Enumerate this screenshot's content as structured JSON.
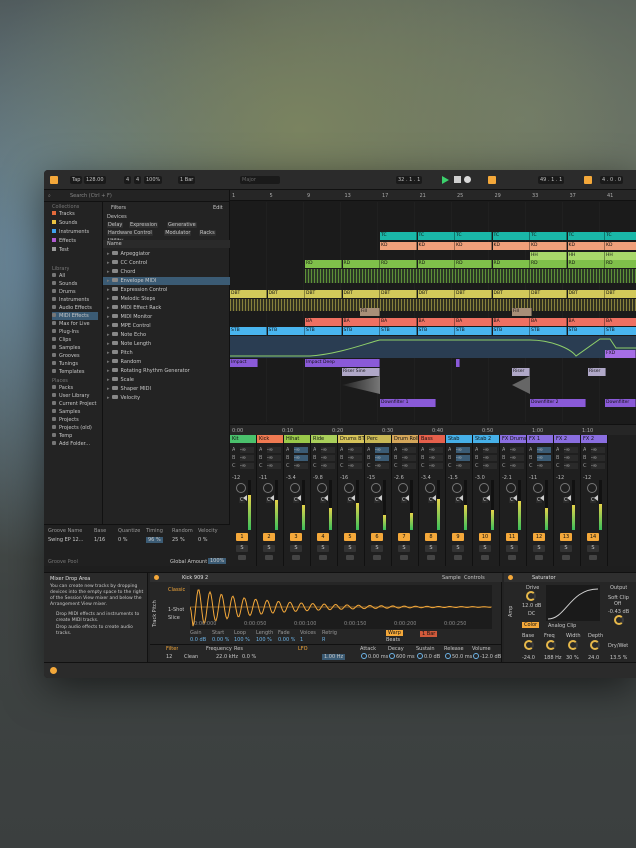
{
  "toolbar": {
    "tap": "Tap",
    "tempo": "128.00",
    "sig_num": "4",
    "sig_den": "4",
    "zoom": "100%",
    "quant": "1 Bar",
    "key": "Major",
    "position": "32 . 1 . 1",
    "loop_start": "49 . 1 . 1",
    "loop_len": "4 . 0 . 0"
  },
  "search": {
    "placeholder": "Search (Ctrl + F)"
  },
  "collections": {
    "title": "Collections",
    "items": [
      {
        "label": "Tracks",
        "color": "#e36a3b"
      },
      {
        "label": "Sounds",
        "color": "#ebc341"
      },
      {
        "label": "Instruments",
        "color": "#3fa3f0"
      },
      {
        "label": "Effects",
        "color": "#b25bd3"
      },
      {
        "label": "Test",
        "color": "#9a9a9a"
      }
    ]
  },
  "library": {
    "title": "Library",
    "items": [
      "All",
      "Sounds",
      "Drums",
      "Instruments",
      "Audio Effects",
      "MIDI Effects",
      "Max for Live",
      "Plug-Ins",
      "Clips",
      "Samples",
      "Grooves",
      "Tunings",
      "Templates"
    ]
  },
  "places": {
    "title": "Places",
    "items": [
      "Packs",
      "User Library",
      "Current Project",
      "Samples",
      "Projects",
      "Projects (old)",
      "Temp",
      "Add Folder..."
    ]
  },
  "filters": {
    "title": "Filters",
    "edit": "Edit",
    "devices": "Devices",
    "tags": [
      "Delay",
      "Expression",
      "Generative",
      "Hardware Control",
      "Modulator",
      "Racks",
      "Utility"
    ]
  },
  "browser": {
    "name_header": "Name",
    "items": [
      "Arpeggiator",
      "CC Control",
      "Chord",
      "Envelope MIDI",
      "Expression Control",
      "Melodic Steps",
      "MIDI Effect Rack",
      "MIDI Monitor",
      "MPE Control",
      "Note Echo",
      "Note Length",
      "Pitch",
      "Random",
      "Rotating Rhythm Generator",
      "Scale",
      "Shaper MIDI",
      "Velocity"
    ],
    "selected": "Envelope MIDI"
  },
  "groove": {
    "headers": [
      "Groove Name",
      "Base",
      "Quantize",
      "Timing",
      "Random",
      "Velocity"
    ],
    "row": {
      "name": "Swing EP 12...",
      "base": "1/16",
      "quantize": "0 %",
      "timing": "96 %",
      "random": "25 %",
      "velocity": "0 %"
    },
    "pool": "Groove Pool",
    "global_label": "Global Amount",
    "global_value": "100%"
  },
  "ruler": {
    "bars": [
      "1",
      "5",
      "9",
      "13",
      "17",
      "21",
      "25",
      "29",
      "33",
      "37",
      "41"
    ]
  },
  "timeline": [
    "0:00",
    "0:10",
    "0:20",
    "0:30",
    "0:40",
    "0:50",
    "1:00",
    "1:10"
  ],
  "clips": {
    "tc": "TC",
    "kd": "KD",
    "hh": "HH",
    "rd": "RD",
    "dbt": "DBT",
    "ba": "BA",
    "stb": "STB",
    "fill": "Fill",
    "impact": "Impact",
    "impact_deep": "Impact Deep",
    "riser_sine": "Riser Sine",
    "riser": "Riser",
    "downfilter1": "Downfilter 1",
    "downfilter2": "Downfilter 2",
    "downfilter": "Downfilter",
    "fx": "FXD"
  },
  "mixer": {
    "tracks": [
      {
        "name": "Kit",
        "color": "#4ac16c",
        "num": "1",
        "vol": "-12",
        "pan": "C"
      },
      {
        "name": "Kick",
        "color": "#f07a52",
        "num": "2",
        "vol": "-11",
        "pan": "C"
      },
      {
        "name": "Hihat",
        "color": "#9ac94a",
        "num": "3",
        "vol": "-3.4",
        "pan": "C"
      },
      {
        "name": "Ride",
        "color": "#a9cf5a",
        "num": "4",
        "vol": "-9.8",
        "pan": "C"
      },
      {
        "name": "Drums BT",
        "color": "#d6c45a",
        "num": "5",
        "vol": "-16",
        "pan": "C"
      },
      {
        "name": "Perc",
        "color": "#c9b855",
        "num": "6",
        "vol": "-15",
        "pan": "C"
      },
      {
        "name": "Drum Roll",
        "color": "#d4a65a",
        "num": "7",
        "vol": "-2.6",
        "pan": "C"
      },
      {
        "name": "Bass",
        "color": "#e6604c",
        "num": "8",
        "vol": "-3.4",
        "pan": "C"
      },
      {
        "name": "Stab",
        "color": "#46b0e8",
        "num": "9",
        "vol": "-1.5",
        "pan": "C"
      },
      {
        "name": "Stab 2",
        "color": "#46b0e8",
        "num": "10",
        "vol": "-3.0",
        "pan": "C"
      },
      {
        "name": "FX Drums",
        "color": "#8a6ee0",
        "num": "11",
        "vol": "-2.1",
        "pan": "C"
      },
      {
        "name": "FX 1",
        "color": "#8a6ee0",
        "num": "12",
        "vol": "-11",
        "pan": "C"
      },
      {
        "name": "FX 2",
        "color": "#8a6ee0",
        "num": "13",
        "vol": "-12",
        "pan": "C"
      },
      {
        "name": "FX 2",
        "color": "#8a6ee0",
        "num": "14",
        "vol": "-12",
        "pan": "C"
      }
    ],
    "sends": [
      "A",
      "B",
      "C"
    ],
    "send_val": "-∞"
  },
  "info": {
    "title": "Mixer Drop Area",
    "body": "You can create new tracks by dropping devices into the empty space to the right of the Session View mixer and below the Arrangement View mixer.",
    "bullets": [
      "Drop MIDI effects and instruments to create MIDI tracks.",
      "Drop audio effects to create audio tracks."
    ]
  },
  "simpler": {
    "title": "Kick 909 2",
    "tabs": [
      "Sample",
      "Controls"
    ],
    "mode": "Classic",
    "mode2": "1-Shot",
    "mode3": "Slice",
    "params": [
      {
        "label": "Gain",
        "value": "0.0 dB"
      },
      {
        "label": "Start",
        "value": "0.00 %"
      },
      {
        "label": "Loop",
        "value": "100 %"
      },
      {
        "label": "Length",
        "value": "100 %"
      },
      {
        "label": "Fade",
        "value": "0.00 %"
      },
      {
        "label": "Voices",
        "value": "1"
      },
      {
        "label": "Retrig",
        "value": "R"
      }
    ],
    "warp": "Warp",
    "beats": "Beats",
    "bpm": "1 Bar",
    "times": [
      "0:00:000",
      "0:00:050",
      "0:00:100",
      "0:00:150",
      "0:00:200",
      "0:00:250"
    ],
    "filter": "Filter",
    "freq_label": "Frequency",
    "res_label": "Res",
    "freq": "22.0 kHz",
    "res": "0.0 %",
    "filter_type": "Clean",
    "filter_val": "12",
    "lfo": "LFO",
    "hz": "1.00 Hz",
    "env": [
      {
        "label": "Attack",
        "value": "0.00 ms"
      },
      {
        "label": "Decay",
        "value": "600 ms"
      },
      {
        "label": "Sustain",
        "value": "0.0 dB"
      },
      {
        "label": "Release",
        "value": "50.0 ms"
      },
      {
        "label": "Volume",
        "value": "-12.0 dB"
      }
    ]
  },
  "saturator": {
    "title": "Saturator",
    "drive_label": "Drive",
    "drive": "12.0 dB",
    "dc": "DC",
    "mode": "Analog Clip",
    "color": "Color",
    "soft_clip": "Soft Clip",
    "soft_clip_val": "Off",
    "output_label": "Output",
    "output": "-0.43 dB",
    "drywet_label": "Dry/Wet",
    "drywet": "13.5 %",
    "knobs": [
      {
        "label": "Base",
        "value": "-24.0"
      },
      {
        "label": "Freq",
        "value": "188 Hz"
      },
      {
        "label": "Width",
        "value": "30 %"
      },
      {
        "label": "Depth",
        "value": "24.0"
      }
    ]
  },
  "strip": {
    "side": "Track Pitch",
    "side2": "Amp"
  },
  "colors": {
    "accent": "#f4a83a",
    "selection": "#3b5b74",
    "bg": "#1e1e1e"
  }
}
